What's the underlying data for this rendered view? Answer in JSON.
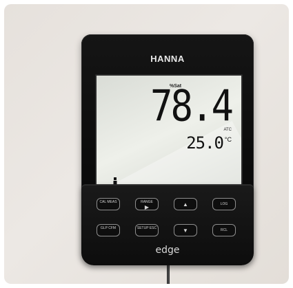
{
  "brand": "HANNA",
  "model": "edge",
  "display": {
    "main_unit": "%Sat",
    "main_value": "78.4",
    "temp_unit_top": "ATC",
    "temp_value": "25.0",
    "temp_unit": "°C"
  },
  "buttons": [
    {
      "name": "cal-meas-button",
      "label": "CAL MEAS"
    },
    {
      "name": "range-button",
      "label": "RANGE",
      "symbol": "▶"
    },
    {
      "name": "up-button",
      "label": "",
      "symbol": "▲"
    },
    {
      "name": "log-button",
      "label": "LOG"
    },
    {
      "name": "glp-cfm-button",
      "label": "GLP CFM"
    },
    {
      "name": "setup-esc-button",
      "label": "SETUP ESC"
    },
    {
      "name": "down-button",
      "label": "",
      "symbol": "▼"
    },
    {
      "name": "rcl-button",
      "label": "RCL"
    }
  ]
}
